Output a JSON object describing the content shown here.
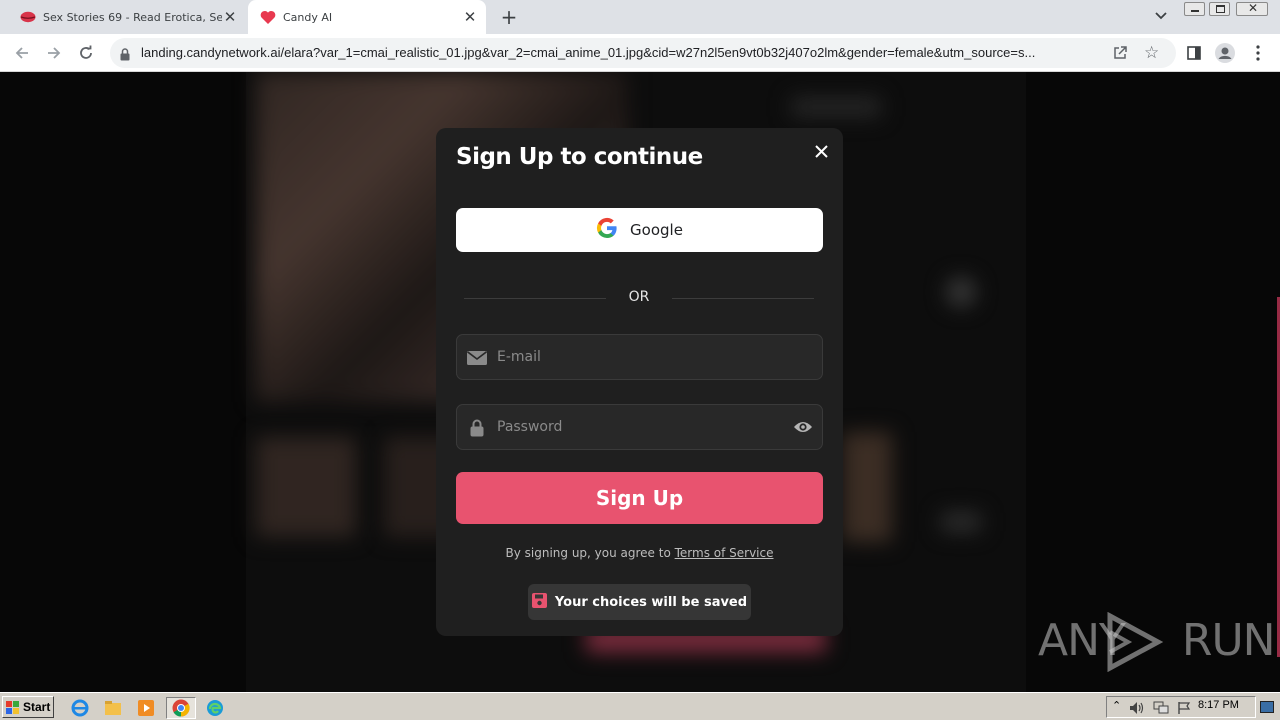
{
  "browser": {
    "tabs": [
      {
        "title": "Sex Stories 69 - Read Erotica, Sex St",
        "icon": "lips-icon",
        "active": false
      },
      {
        "title": "Candy AI",
        "icon": "heart-icon",
        "active": true
      }
    ],
    "new_tab_label": "+",
    "url": "landing.candynetwork.ai/elara?var_1=cmai_realistic_01.jpg&var_2=cmai_anime_01.jpg&cid=w27n2l5en9vt0b32j407o2lm&gender=female&utm_source=s..."
  },
  "modal": {
    "title": "Sign Up to continue",
    "google_label": "Google",
    "or_label": "OR",
    "email_placeholder": "E-mail",
    "password_placeholder": "Password",
    "signup_label": "Sign Up",
    "terms_prefix": "By signing up, you agree to ",
    "terms_link": "Terms of Service",
    "saved_label": "Your choices will be saved"
  },
  "watermark": {
    "text": "ANY RUN"
  },
  "taskbar": {
    "start_label": "Start",
    "clock": "8:17 PM"
  },
  "colors": {
    "accent": "#e8536f",
    "modal_bg": "#1f1f1f",
    "field_bg": "#282828"
  }
}
